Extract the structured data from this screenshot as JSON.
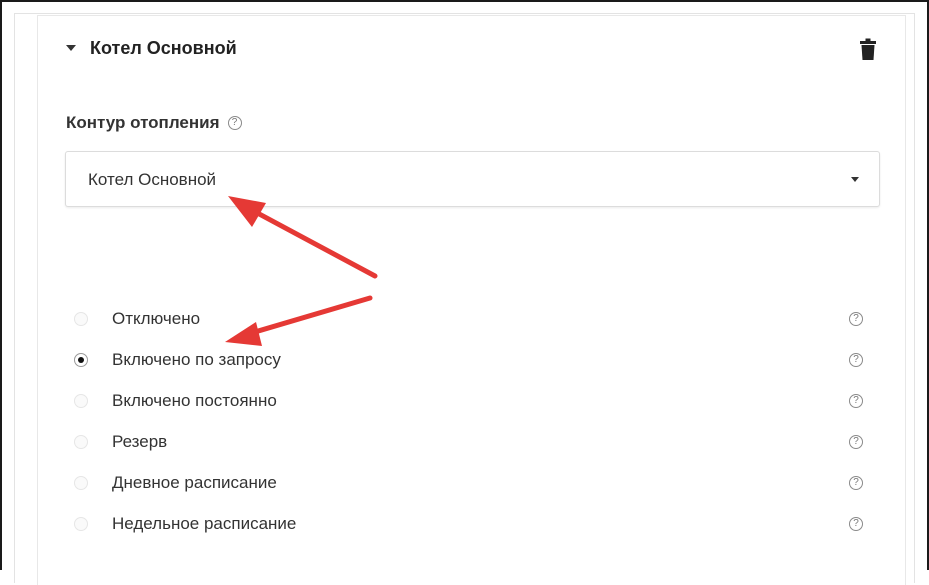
{
  "card": {
    "title": "Котел Основной",
    "collapse_icon": "caret-down-icon",
    "delete_icon": "trash-icon"
  },
  "heating_circuit": {
    "label": "Контур отопления",
    "help_icon": "help-icon",
    "selected_value": "Котел Основной",
    "dropdown_icon": "chevron-down-icon"
  },
  "modes": [
    {
      "label": "Отключено",
      "checked": false
    },
    {
      "label": "Включено по запросу",
      "checked": true
    },
    {
      "label": "Включено постоянно",
      "checked": false
    },
    {
      "label": "Резерв",
      "checked": false
    },
    {
      "label": "Дневное расписание",
      "checked": false
    },
    {
      "label": "Недельное расписание",
      "checked": false
    }
  ],
  "help_glyph": "?",
  "colors": {
    "annotation_arrow": "#e53935",
    "text": "#333333",
    "border": "#dcdcdc"
  }
}
